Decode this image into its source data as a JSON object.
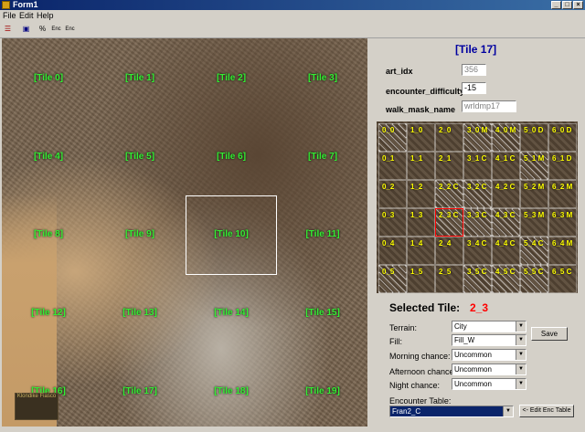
{
  "window": {
    "title": "Form1",
    "min": "_",
    "max": "□",
    "close": "×"
  },
  "menu": {
    "file": "File",
    "edit": "Edit",
    "help": "Help"
  },
  "toolbar": {
    "icon1": "☰",
    "save": "▣",
    "pct": "%",
    "enc1": "Enc",
    "enc2": "Enc"
  },
  "map": {
    "tiles": [
      "[Tile 0]",
      "[Tile 1]",
      "[Tile 2]",
      "[Tile 3]",
      "[Tile 4]",
      "[Tile 5]",
      "[Tile 6]",
      "[Tile 7]",
      "[Tile 8]",
      "[Tile 9]",
      "[Tile 10]",
      "[Tile 11]",
      "[Tile 12]",
      "[Tile 13]",
      "[Tile 14]",
      "[Tile 15]",
      "[Tile 16]",
      "[Tile 17]",
      "[Tile 18]",
      "[Tile 19]"
    ],
    "logo_text": "Klondike Fiasco"
  },
  "panel": {
    "heading": "[Tile 17]",
    "art_idx_label": "art_idx",
    "art_idx_value": "356",
    "encounter_label": "encounter_difficulty",
    "encounter_value": "-15",
    "walk_mask_label": "walk_mask_name",
    "walk_mask_value": "wrldmp17",
    "grid": [
      [
        "0_0",
        "1_0",
        "2_0",
        "3_0 M",
        "4_0 M",
        "5_0 D",
        "6_0 D"
      ],
      [
        "0_1",
        "1_1",
        "2_1",
        "3_1 C",
        "4_1 C",
        "5_1 M",
        "6_1 D"
      ],
      [
        "0_2",
        "1_2",
        "2_2 C",
        "3_2 C",
        "4_2 C",
        "5_2 M",
        "6_2 M"
      ],
      [
        "0_3",
        "1_3",
        "2_3 C",
        "3_3 C",
        "4_3 C",
        "5_3 M",
        "6_3 M"
      ],
      [
        "0_4",
        "1_4",
        "2_4",
        "3_4 C",
        "4_4 C",
        "5_4 C",
        "6_4 M"
      ],
      [
        "0_5",
        "1_5",
        "2_5",
        "3_5 C",
        "4_5 C",
        "5_5 C",
        "6_5 C"
      ]
    ],
    "selected_label": "Selected Tile:",
    "selected_value": "2_3",
    "terrain_label": "Terrain:",
    "terrain_value": "City",
    "fill_label": "Fill:",
    "fill_value": "Fill_W",
    "morning_label": "Morning chance:",
    "morning_value": "Uncommon",
    "afternoon_label": "Afternoon chance:",
    "afternoon_value": "Uncommon",
    "night_label": "Night chance:",
    "night_value": "Uncommon",
    "enc_table_label": "Encounter Table:",
    "enc_table_value": "Fran2_C",
    "save_button": "Save",
    "edit_enc_button": "<- Edit Enc Table"
  },
  "colors": {
    "tile_label": "#33ee33",
    "selected_value": "#ff0000",
    "heading": "#0000a0",
    "grid_text": "#ffff00"
  }
}
